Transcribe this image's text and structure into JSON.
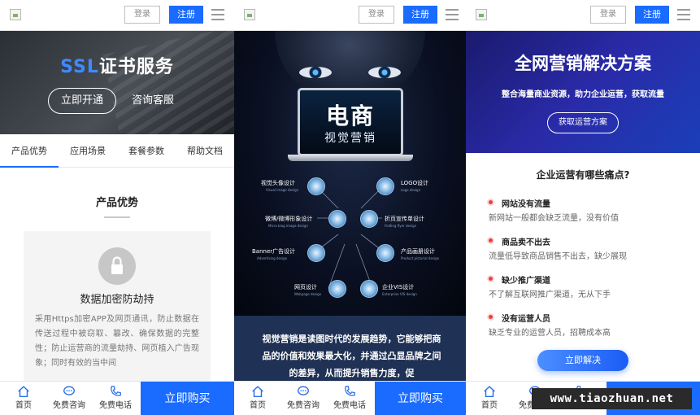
{
  "topbar": {
    "login_label": "登录",
    "register_label": "注册"
  },
  "bottombar": {
    "home_label": "首页",
    "consult_label": "免费咨询",
    "phone_label": "免费电话",
    "buy_label": "立即购买"
  },
  "ssl": {
    "title_ssl": "SSL",
    "title_rest": "证书服务",
    "open_button": "立即开通",
    "consult_button": "咨询客服",
    "tabs": [
      "产品优势",
      "应用场景",
      "套餐参数",
      "帮助文档"
    ],
    "section_title": "产品优势",
    "card_title": "数据加密防劫持",
    "card_desc": "采用Https加密APP及网页通讯，防止数据在传送过程中被窃取、篡改、确保数据的完整性；防止运营商的流量劫持、网页植入广告现象；同时有效的当中间"
  },
  "ecom": {
    "screen_title": "电商",
    "screen_sub": "视觉营销",
    "nodes": [
      {
        "label": "视觉头像设计",
        "sub": "Visual image design"
      },
      {
        "label": "LOGO设计",
        "sub": "Logo design"
      },
      {
        "label": "微博/微博形象设计",
        "sub": "Micro blog image design"
      },
      {
        "label": "折页宣传单设计",
        "sub": "Folding flyer design"
      },
      {
        "label": "Banner广告设计",
        "sub": "Advertising design"
      },
      {
        "label": "产品画册设计",
        "sub": "Product pictorial design"
      },
      {
        "label": "网页设计",
        "sub": "Webpage design"
      },
      {
        "label": "企业VIS设计",
        "sub": "Enterprise VIS design"
      }
    ],
    "desc": "视觉营销是读图时代的发展趋势，它能够把商品的价值和效果最大化，并通过凸显品牌之间的差异，从而提升销售力度，促"
  },
  "marketing": {
    "title": "全网营销解决方案",
    "subtitle": "整合海量商业资源，助力企业运营，获取流量",
    "cta": "获取运营方案",
    "section_title": "企业运营有哪些痛点?",
    "pains": [
      {
        "title": "网站没有流量",
        "desc": "新网站一般都会缺乏流量，没有价值"
      },
      {
        "title": "商品卖不出去",
        "desc": "流量低导致商品销售不出去，缺少展现"
      },
      {
        "title": "缺少推广渠道",
        "desc": "不了解互联网推广渠道，无从下手"
      },
      {
        "title": "没有运营人员",
        "desc": "缺乏专业的运营人员，招聘成本高"
      }
    ],
    "solve_button": "立即解决"
  },
  "watermark": "www.tiaozhuan.net",
  "colors": {
    "accent": "#1a6bff",
    "dot": "#f23c3c"
  }
}
